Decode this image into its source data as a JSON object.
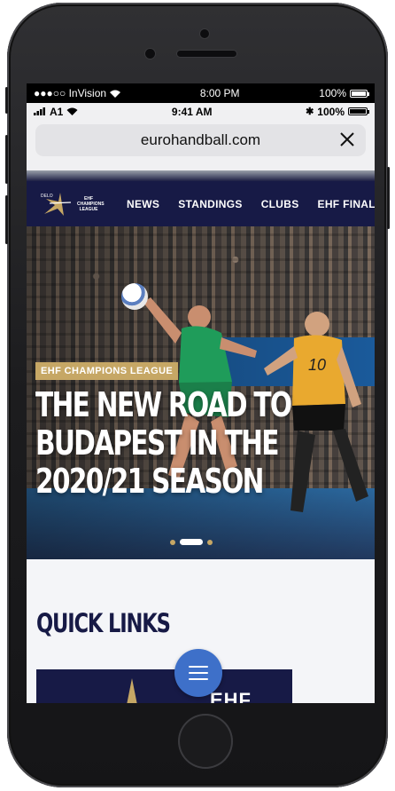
{
  "device": {
    "outer_status": {
      "carrier": "●●●○○ InVision",
      "time": "8:00 PM",
      "battery": "100%"
    },
    "inner_status": {
      "carrier": "A1",
      "time": "9:41 AM",
      "battery": "100%"
    }
  },
  "browser": {
    "url": "eurohandball.com"
  },
  "nav": {
    "logo_small": "DELO",
    "logo_text": "EHF CHAMPIONS LEAGUE",
    "items": [
      "NEWS",
      "STANDINGS",
      "CLUBS",
      "EHF FINAL"
    ]
  },
  "hero": {
    "badge": "EHF CHAMPIONS LEAGUE",
    "headline_lines": [
      "THE NEW ROAD TO",
      "BUDAPEST IN THE",
      "2020/21 SEASON"
    ],
    "player_number": "10",
    "slides": 3,
    "active_slide": 2
  },
  "quick_links": {
    "title": "QUICK LINKS",
    "card_text": "EHF"
  },
  "colors": {
    "navy": "#171a46",
    "gold": "#c6a765",
    "fab_blue": "#3e70c9",
    "page_bg": "#f4f5f8"
  }
}
